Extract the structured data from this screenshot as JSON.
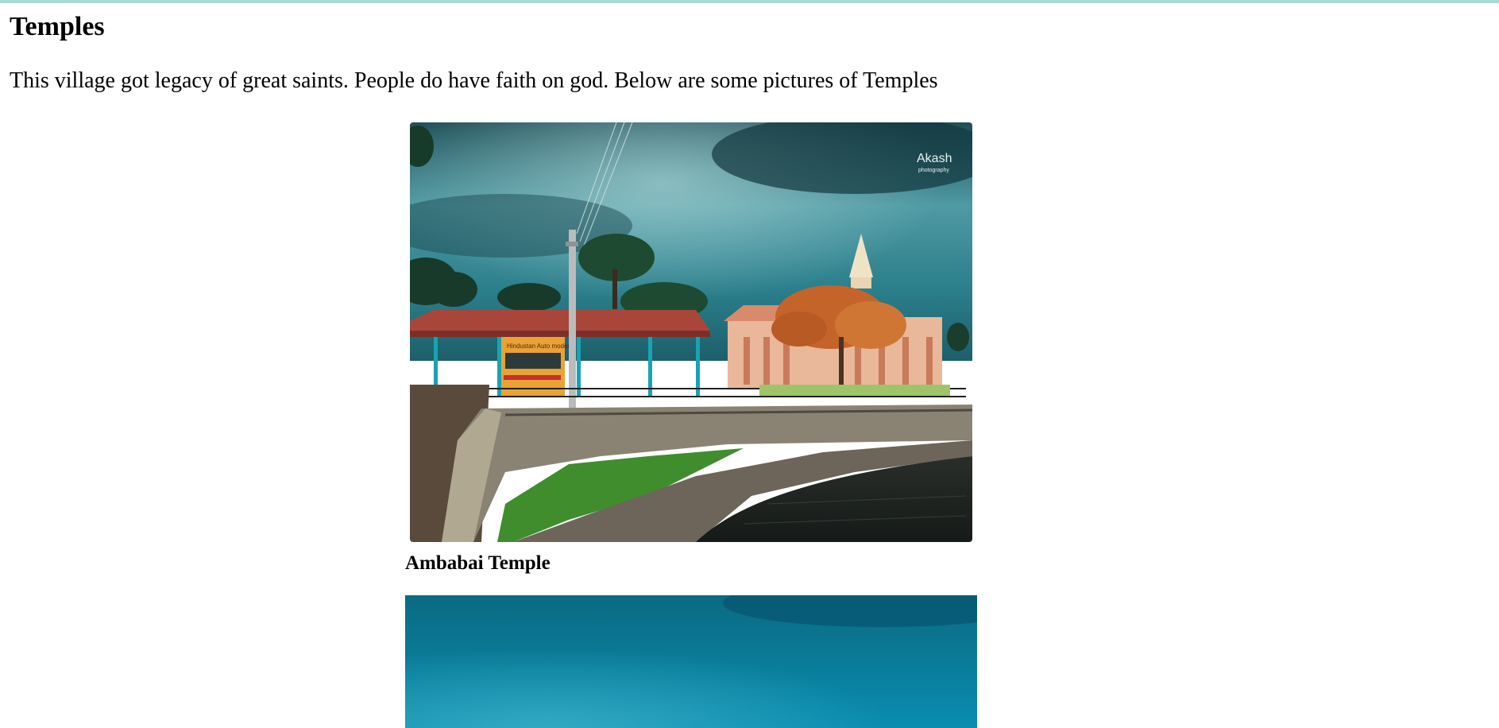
{
  "page": {
    "title": "Temples",
    "intro": "This village got legacy of great saints. People do have faith on god. Below are some pictures of Temples"
  },
  "gallery": [
    {
      "caption": "Ambabai Temple",
      "watermark": {
        "name": "Akash",
        "sub": "photography"
      },
      "shop_sign": "Hindustan Auto modern"
    },
    {
      "caption": ""
    }
  ],
  "colors": {
    "accent_strip": "#a9d9d6",
    "sky_teal": "#2e8a95",
    "water_teal": "#078aa6"
  }
}
